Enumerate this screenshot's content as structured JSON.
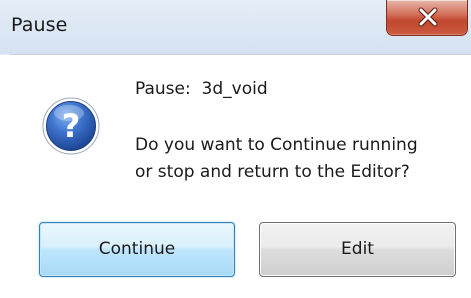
{
  "window": {
    "title": "Pause"
  },
  "titlebar": {
    "close_icon": "close-x-icon"
  },
  "message": {
    "icon": "question-icon",
    "line1": "Pause:  3d_void",
    "body_line1": "Do you want to Continue running",
    "body_line2": "or stop and return to the Editor?"
  },
  "buttons": {
    "continue_label": "Continue",
    "edit_label": "Edit"
  },
  "colors": {
    "close_button": "#c7503a",
    "continue_border": "#3c7fb1",
    "question_icon": "#2a5aa8"
  }
}
